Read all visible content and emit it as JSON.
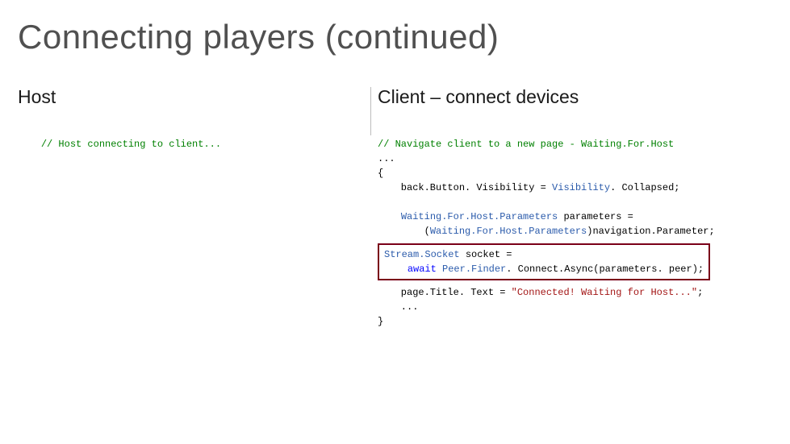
{
  "slide": {
    "title": "Connecting players (continued)"
  },
  "left": {
    "heading": "Host",
    "code": {
      "comment": "// Host connecting to client..."
    }
  },
  "right": {
    "heading": "Client – connect devices",
    "code": {
      "comment": "// Navigate client to a new page - Waiting.For.Host",
      "ellipsis1": "...",
      "open": "{",
      "line1_pre": "    back.Button. Visibility = ",
      "line1_type": "Visibility",
      "line1_post": ". Collapsed;",
      "line2a_type": "Waiting.For.Host.Parameters",
      "line2a_post": " parameters =",
      "line2b_pre": "    (",
      "line2b_type": "Waiting.For.Host.Parameters",
      "line2b_post": ")navigation.Parameter;",
      "hl_line1_type": "Stream.Socket",
      "hl_line1_post": " socket =",
      "hl_line2_pre": "    ",
      "hl_line2_kw": "await",
      "hl_line2_mid": " ",
      "hl_line2_type": "Peer.Finder",
      "hl_line2_post": ". Connect.Async(parameters. peer);",
      "line3_pre": "    page.Title. Text = ",
      "line3_str": "\"Connected! Waiting for Host...\"",
      "line3_post": ";",
      "ellipsis2": "    ...",
      "close": "}"
    }
  }
}
